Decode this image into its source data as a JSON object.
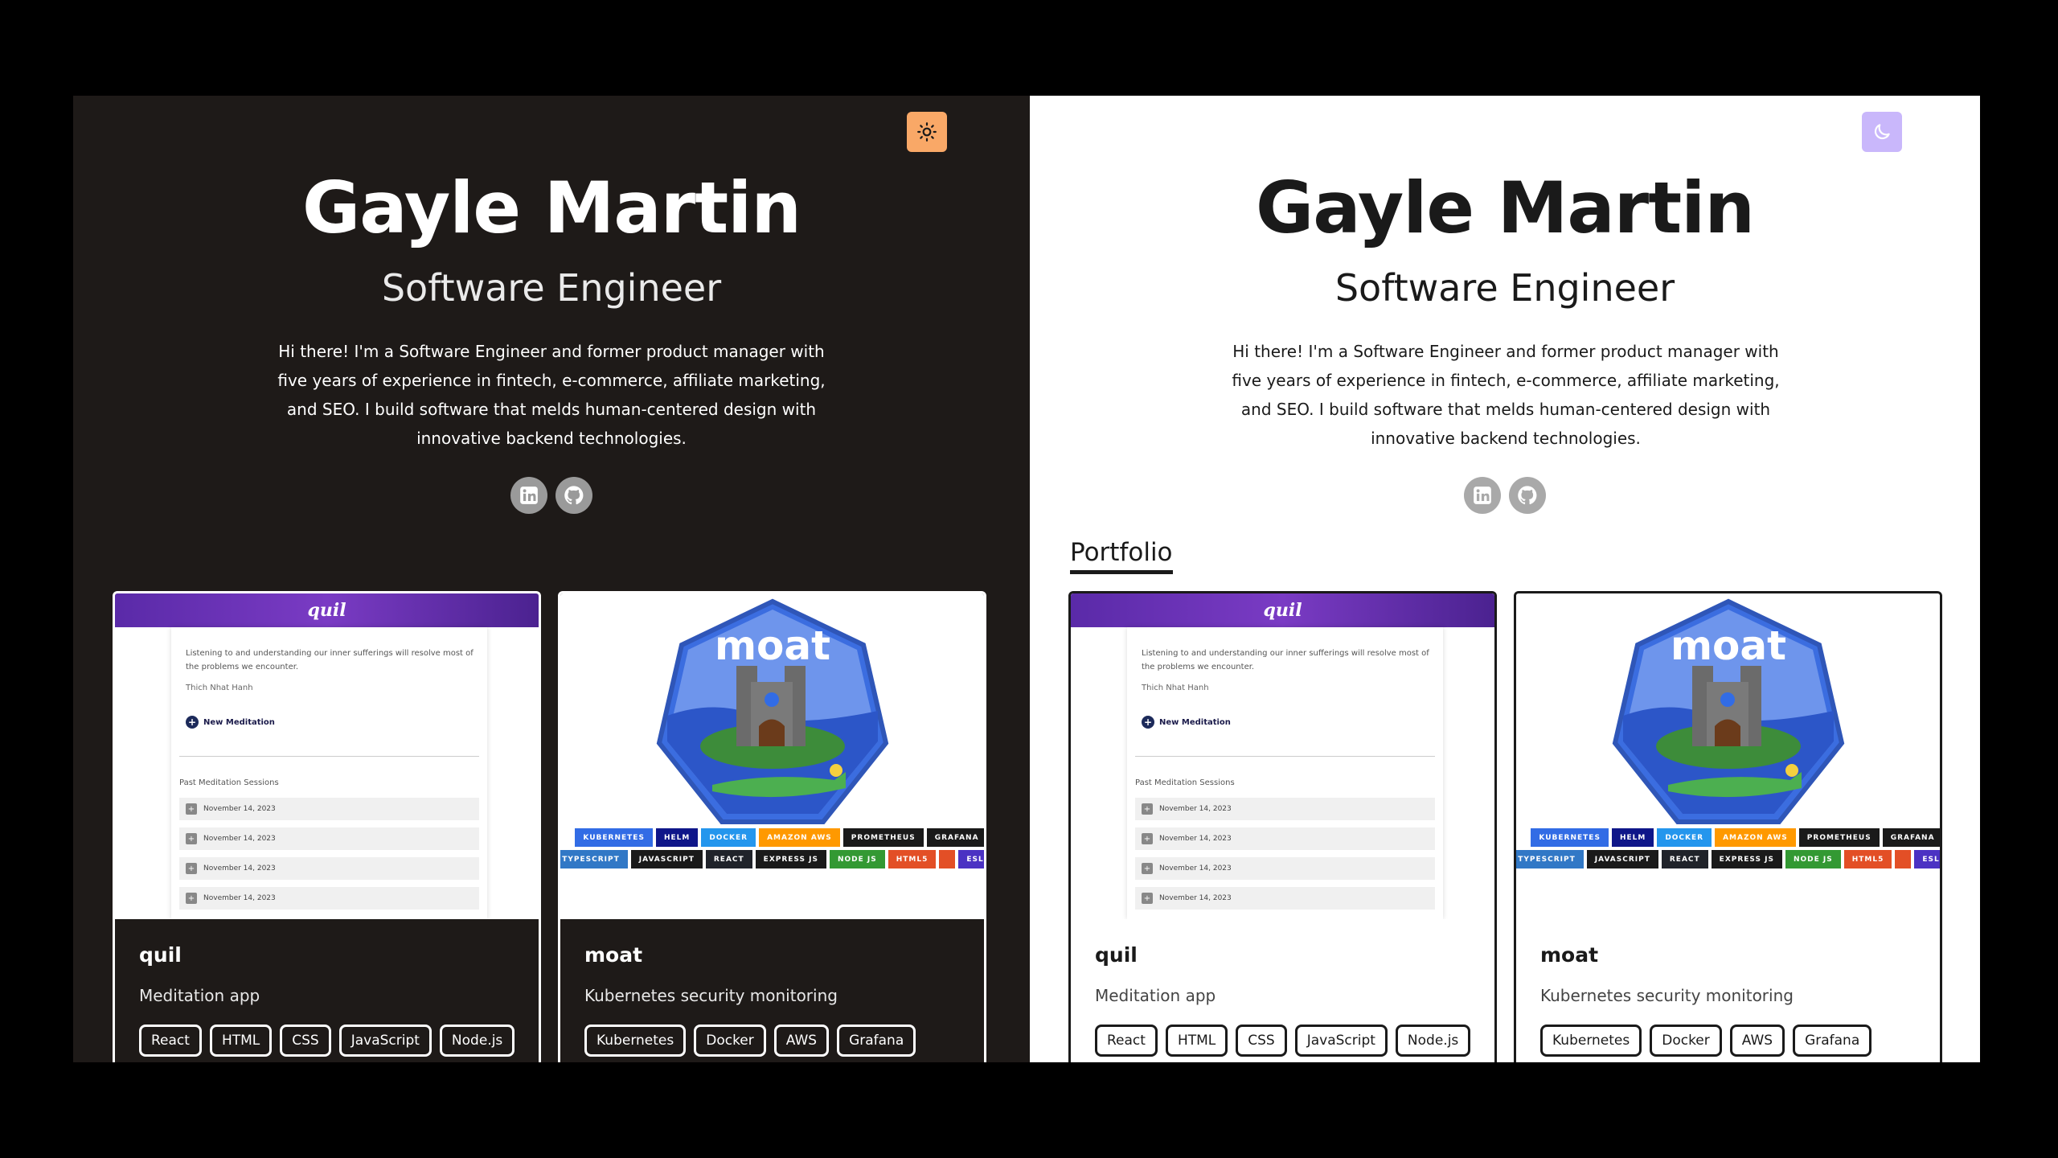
{
  "profile": {
    "name": "Gayle Martin",
    "title": "Software Engineer",
    "bio": "Hi there! I'm a Software Engineer and former product manager with five years of experience in fintech, e-commerce, affiliate marketing, and SEO. I build software that melds human-centered design with innovative backend technologies."
  },
  "socials": [
    {
      "icon": "linkedin-icon"
    },
    {
      "icon": "github-icon"
    }
  ],
  "portfolio": {
    "heading": "Portfolio"
  },
  "theme": {
    "dark_toggle_icon": "sun-icon",
    "light_toggle_icon": "moon-icon",
    "dark_bg": "#1e1a18",
    "light_bg": "#ffffff",
    "sun_button": "#f9a867",
    "moon_button": "#c9b7fb"
  },
  "projects": [
    {
      "title": "quil",
      "description": "Meditation app",
      "tags": [
        "React",
        "HTML",
        "CSS",
        "JavaScript",
        "Node.js"
      ],
      "preview": {
        "logo": "quil",
        "quote": "Listening to and understanding our inner sufferings will resolve most of the problems we encounter.",
        "author": "Thich Nhat Hanh",
        "new_button": "New Meditation",
        "past_label": "Past Meditation Sessions",
        "sessions": [
          "November 14, 2023",
          "November 14, 2023",
          "November 14, 2023",
          "November 14, 2023"
        ]
      }
    },
    {
      "title": "moat",
      "description": "Kubernetes security monitoring",
      "tags": [
        "Kubernetes",
        "Docker",
        "AWS",
        "Grafana"
      ],
      "preview": {
        "logo": "moat",
        "badges": [
          {
            "label": "KUBERNETES",
            "color": "#326ce5"
          },
          {
            "label": "HELM",
            "color": "#0f1689"
          },
          {
            "label": "DOCKER",
            "color": "#2496ed"
          },
          {
            "label": "AMAZON AWS",
            "color": "#ff9900"
          },
          {
            "label": "PROMETHEUS",
            "color": "#1a1a1a"
          },
          {
            "label": "GRAFANA",
            "color": "#1a1a1a"
          },
          {
            "label": "TYPESCRIPT",
            "color": "#3178c6"
          },
          {
            "label": "JAVASCRIPT",
            "color": "#1a1a1a"
          },
          {
            "label": "REACT",
            "color": "#20232a"
          },
          {
            "label": "EXPRESS JS",
            "color": "#1a1a1a"
          },
          {
            "label": "NODE JS",
            "color": "#339933"
          },
          {
            "label": "HTML5",
            "color": "#e34f26"
          },
          {
            "label": "",
            "color": "#e34f26"
          },
          {
            "label": "ESLINT",
            "color": "#4b32c3"
          }
        ]
      }
    }
  ]
}
